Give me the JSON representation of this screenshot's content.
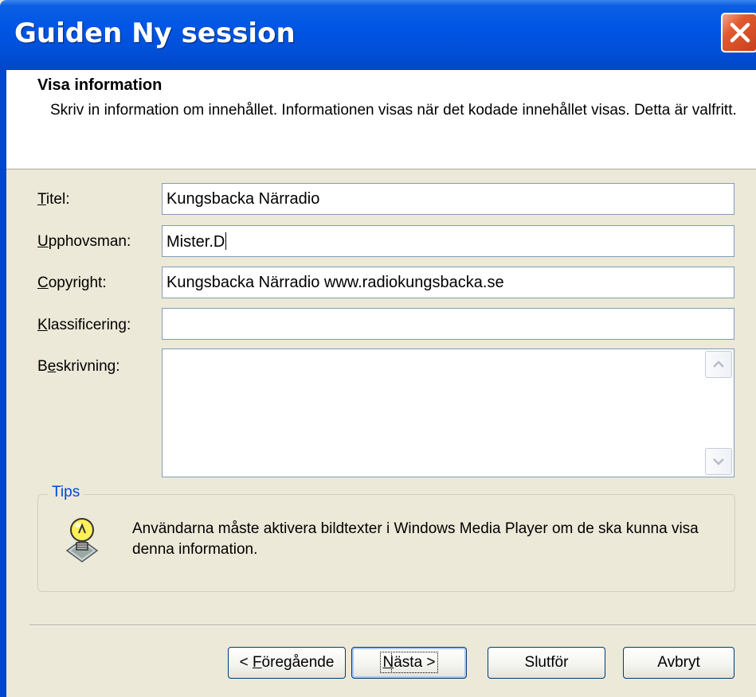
{
  "window": {
    "title": "Guiden Ny session",
    "close_icon": "close-icon"
  },
  "header": {
    "title": "Visa information",
    "description": "Skriv in information om innehållet. Informationen visas när det kodade innehållet visas. Detta är valfritt."
  },
  "form": {
    "titel": {
      "label_access": "T",
      "label_rest": "itel:",
      "value": "Kungsbacka Närradio"
    },
    "upphovsman": {
      "label_access": "U",
      "label_rest": "pphovsman:",
      "value": "Mister.D"
    },
    "copyright": {
      "label_access": "C",
      "label_rest": "opyright:",
      "value": "Kungsbacka Närradio www.radiokungsbacka.se"
    },
    "klassificering": {
      "label_access": "K",
      "label_rest": "lassificering:",
      "value": ""
    },
    "beskrivning": {
      "label_pre": "B",
      "label_access": "e",
      "label_rest": "skrivning:",
      "value": ""
    }
  },
  "tips": {
    "legend": "Tips",
    "icon": "lightbulb-icon",
    "text": "Användarna måste aktivera bildtexter i Windows Media Player om de ska kunna visa denna information."
  },
  "buttons": {
    "back": {
      "pre": "< ",
      "access": "F",
      "rest": "öregående"
    },
    "next": {
      "access": "N",
      "rest": "ästa >"
    },
    "finish": "Slutför",
    "cancel": "Avbryt"
  }
}
